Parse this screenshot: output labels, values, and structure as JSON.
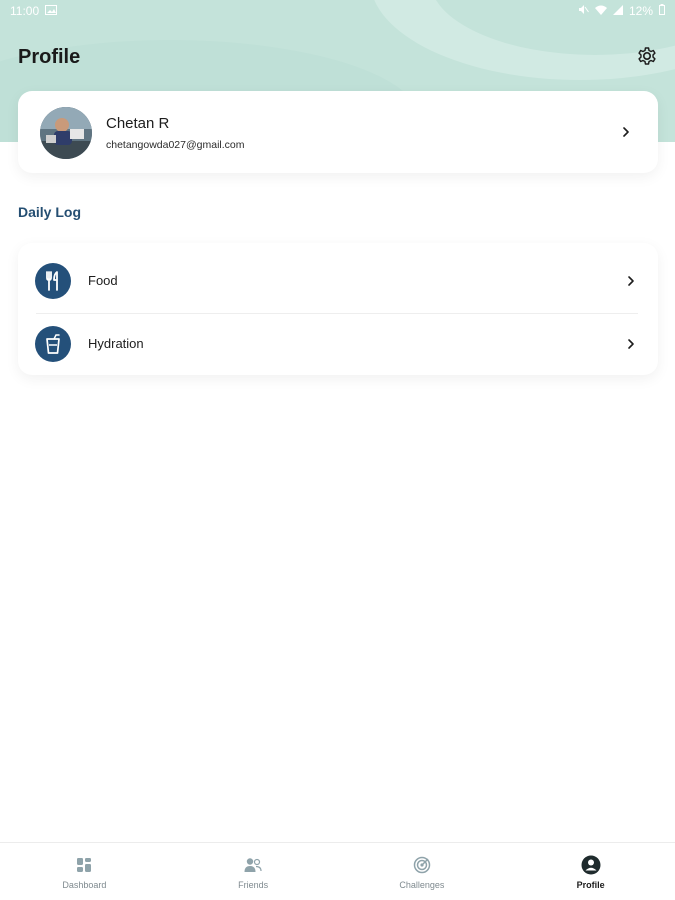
{
  "status_bar": {
    "time": "11:00",
    "battery": "12%",
    "icons": [
      "image-icon",
      "mute-icon",
      "wifi-icon",
      "signal-icon",
      "battery-icon"
    ]
  },
  "header": {
    "title": "Profile",
    "settings_icon": "gear-icon"
  },
  "profile": {
    "name": "Chetan R",
    "email": "chetangowda027@gmail.com"
  },
  "daily_log": {
    "title": "Daily Log",
    "items": [
      {
        "label": "Food",
        "icon": "fork-knife-icon"
      },
      {
        "label": "Hydration",
        "icon": "glass-icon"
      }
    ]
  },
  "bottom_nav": {
    "items": [
      {
        "label": "Dashboard",
        "icon": "grid-icon",
        "active": false
      },
      {
        "label": "Friends",
        "icon": "people-icon",
        "active": false
      },
      {
        "label": "Challenges",
        "icon": "target-icon",
        "active": false
      },
      {
        "label": "Profile",
        "icon": "person-icon",
        "active": true
      }
    ]
  },
  "colors": {
    "header_bg": "#c4e3da",
    "accent": "#24507a",
    "section_title": "#244e72"
  }
}
